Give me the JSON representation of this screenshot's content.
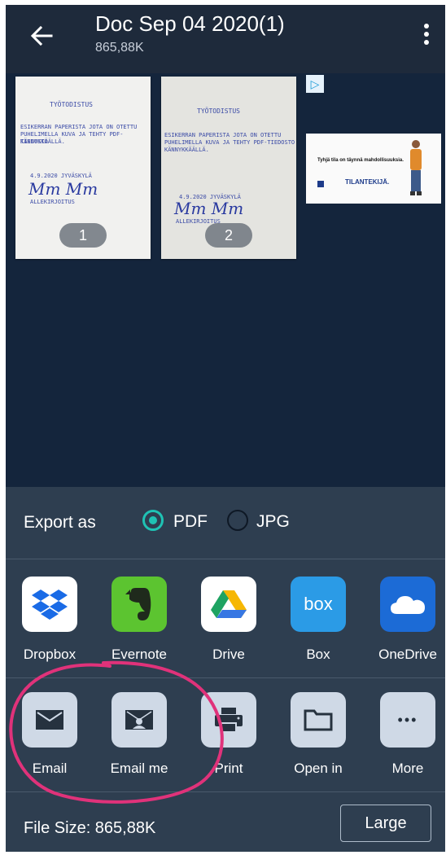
{
  "header": {
    "title": "Doc Sep 04 2020(1)",
    "file_size": "865,88K",
    "back_icon": "arrow-left-icon",
    "menu_icon": "more-vert-icon"
  },
  "pages": [
    {
      "number": "1",
      "heading": "TYÖTODISTUS",
      "lines": [
        "ESIKERRAN PAPERISTA JOTA ON OTETTU",
        "PUHELIMELLA KUVA JA TEHTY PDF-TIEDOSTO",
        "KÄNNYKKÄÄLLÄ."
      ],
      "date_line": "4.9.2020 JYVÄSKYLÄ",
      "signature": "Mm Mm",
      "caption": "ALLEKIRJOITUS"
    },
    {
      "number": "2",
      "heading": "TYÖTODISTUS",
      "lines": [
        "ESIKERRAN PAPERISTA JOTA ON OTETTU",
        "PUHELIMELLA KUVA JA TEHTY PDF-TIEDOSTO",
        "KÄNNYKKÄÄLLÄ."
      ],
      "date_line": "4.9.2020 JYVÄSKYLÄ",
      "signature": "Mm Mm",
      "caption": "ALLEKIRJOITUS"
    }
  ],
  "ad": {
    "badge": "▷",
    "headline": "Tyhjä tila on täynnä mahdollisuuksia.",
    "brand": "TILANTEKIJÄ."
  },
  "export": {
    "label": "Export as",
    "options": [
      {
        "label": "PDF",
        "selected": true
      },
      {
        "label": "JPG",
        "selected": false
      }
    ]
  },
  "share_targets": [
    {
      "label": "Dropbox",
      "icon": "dropbox-icon",
      "color": "#ffffff"
    },
    {
      "label": "Evernote",
      "icon": "evernote-icon",
      "color": "#5cc430"
    },
    {
      "label": "Drive",
      "icon": "google-drive-icon",
      "color": "#ffffff"
    },
    {
      "label": "Box",
      "icon": "box-icon",
      "color": "#2b9be6",
      "glyph": "box"
    },
    {
      "label": "OneDrive",
      "icon": "onedrive-icon",
      "color": "#1c6bd6"
    }
  ],
  "actions": [
    {
      "label": "Email",
      "icon": "envelope-icon"
    },
    {
      "label": "Email me",
      "icon": "email-me-icon"
    },
    {
      "label": "Print",
      "icon": "printer-icon"
    },
    {
      "label": "Open in",
      "icon": "folder-icon"
    },
    {
      "label": "More",
      "icon": "more-horiz-icon",
      "glyph": "•••"
    }
  ],
  "footer": {
    "file_size_label": "File Size: 865,88K",
    "quality_button": "Large"
  },
  "colors": {
    "accent": "#1fc2b4",
    "annotation": "#e0327a"
  }
}
